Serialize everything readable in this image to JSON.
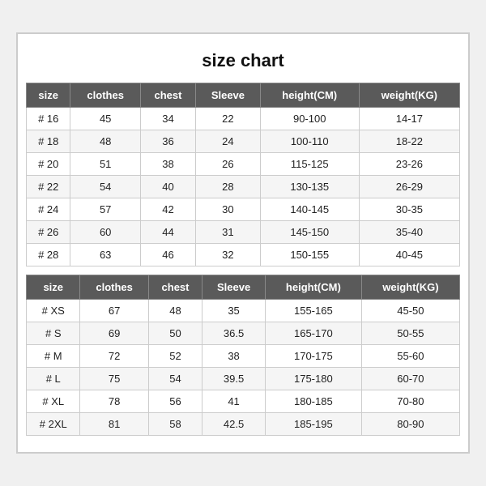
{
  "title": "size chart",
  "table1": {
    "headers": [
      "size",
      "clothes",
      "chest",
      "Sleeve",
      "height(CM)",
      "weight(KG)"
    ],
    "rows": [
      [
        "# 16",
        "45",
        "34",
        "22",
        "90-100",
        "14-17"
      ],
      [
        "# 18",
        "48",
        "36",
        "24",
        "100-110",
        "18-22"
      ],
      [
        "# 20",
        "51",
        "38",
        "26",
        "115-125",
        "23-26"
      ],
      [
        "# 22",
        "54",
        "40",
        "28",
        "130-135",
        "26-29"
      ],
      [
        "# 24",
        "57",
        "42",
        "30",
        "140-145",
        "30-35"
      ],
      [
        "# 26",
        "60",
        "44",
        "31",
        "145-150",
        "35-40"
      ],
      [
        "# 28",
        "63",
        "46",
        "32",
        "150-155",
        "40-45"
      ]
    ]
  },
  "table2": {
    "headers": [
      "size",
      "clothes",
      "chest",
      "Sleeve",
      "height(CM)",
      "weight(KG)"
    ],
    "rows": [
      [
        "# XS",
        "67",
        "48",
        "35",
        "155-165",
        "45-50"
      ],
      [
        "# S",
        "69",
        "50",
        "36.5",
        "165-170",
        "50-55"
      ],
      [
        "# M",
        "72",
        "52",
        "38",
        "170-175",
        "55-60"
      ],
      [
        "# L",
        "75",
        "54",
        "39.5",
        "175-180",
        "60-70"
      ],
      [
        "# XL",
        "78",
        "56",
        "41",
        "180-185",
        "70-80"
      ],
      [
        "# 2XL",
        "81",
        "58",
        "42.5",
        "185-195",
        "80-90"
      ]
    ]
  }
}
